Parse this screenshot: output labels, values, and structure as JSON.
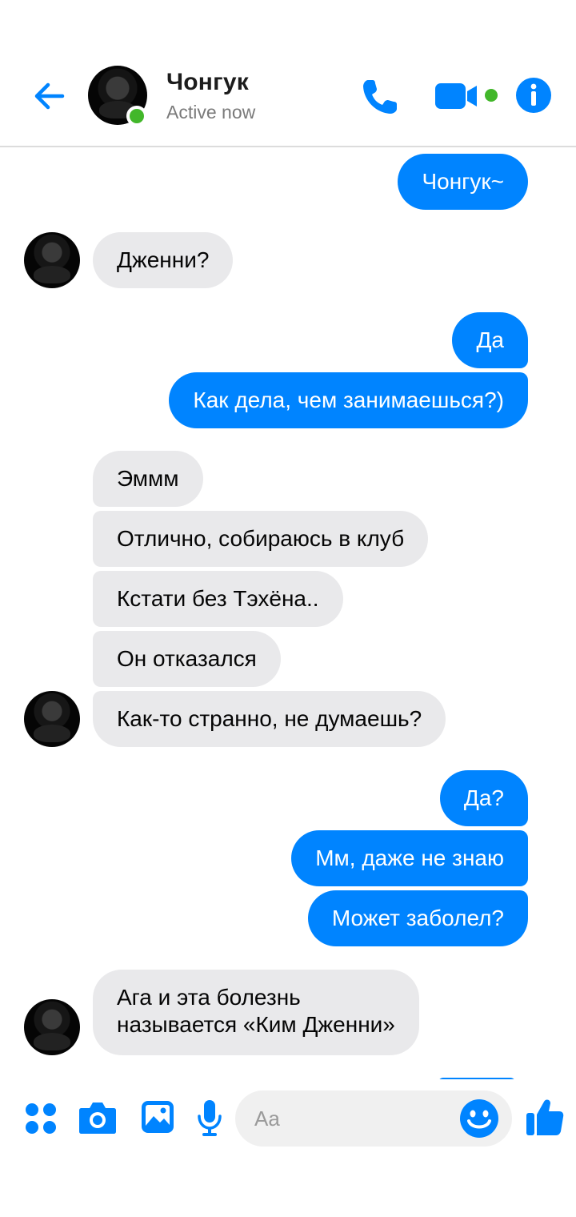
{
  "header": {
    "contact_name": "Чонгук",
    "status": "Active now"
  },
  "messages": [
    {
      "text": "Чонгук~",
      "from": "me"
    },
    {
      "text": "Дженни?",
      "from": "them"
    },
    {
      "text": "Да",
      "from": "me"
    },
    {
      "text": "Как дела, чем занимаешься?)",
      "from": "me"
    },
    {
      "text": "Эммм",
      "from": "them"
    },
    {
      "text": "Отлично, собираюсь в клуб",
      "from": "them"
    },
    {
      "text": "Кстати без Тэхёна..",
      "from": "them"
    },
    {
      "text": "Он отказался",
      "from": "them"
    },
    {
      "text": "Как-то странно, не думаешь?",
      "from": "them"
    },
    {
      "text": "Да?",
      "from": "me"
    },
    {
      "text": "Мм, даже не знаю",
      "from": "me"
    },
    {
      "text": "Может заболел?",
      "from": "me"
    },
    {
      "text": "Ага и эта болезнь",
      "text2": "называется «Ким Дженни»",
      "from": "them"
    }
  ],
  "composer": {
    "placeholder": "Aa"
  },
  "colors": {
    "accent": "#0084ff",
    "incoming_bubble": "#e9e9eb",
    "online": "#42b72a"
  },
  "icons": [
    "back-arrow-icon",
    "phone-icon",
    "video-camera-icon",
    "info-icon",
    "apps-grid-icon",
    "camera-icon",
    "gallery-icon",
    "microphone-icon",
    "emoji-icon",
    "thumbs-up-icon"
  ]
}
